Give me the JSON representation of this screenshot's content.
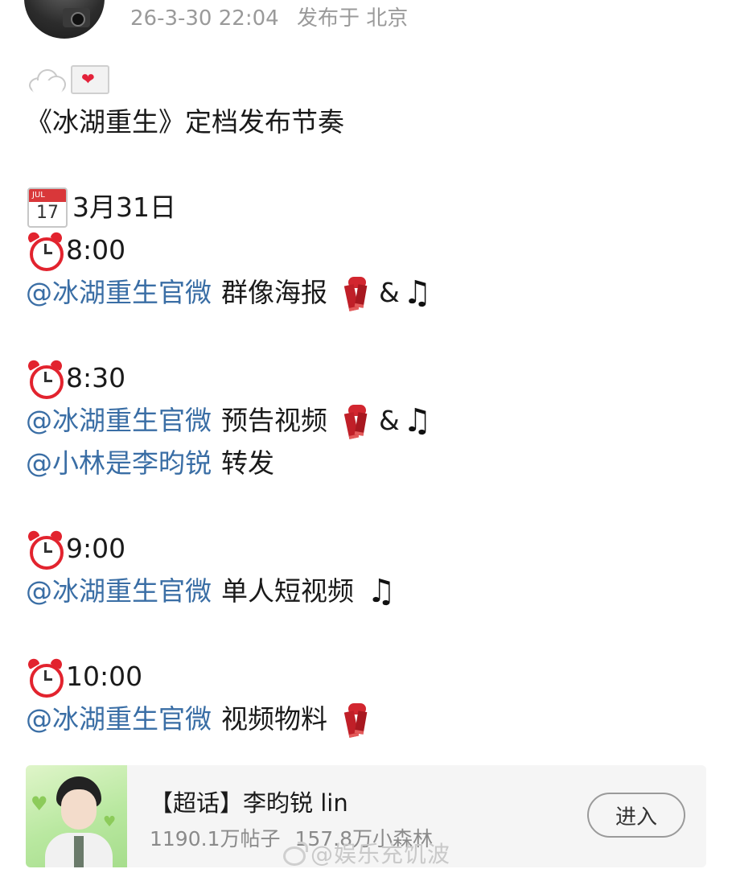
{
  "header": {
    "datetime": "26-3-30 22:04",
    "location": "发布于 北京"
  },
  "post": {
    "title": "《冰湖重生》定档发布节奏",
    "date": "3月31日",
    "calendar_month": "JUL",
    "calendar_day": "17",
    "schedule": [
      {
        "time": "8:00",
        "items": [
          {
            "mention": "@冰湖重生官微",
            "text": "群像海报",
            "emojis": [
              "scarf",
              "&",
              "music-note"
            ]
          }
        ]
      },
      {
        "time": "8:30",
        "items": [
          {
            "mention": "@冰湖重生官微",
            "text": "预告视频",
            "emojis": [
              "scarf",
              "&",
              "music-note"
            ]
          },
          {
            "mention": "@小林是李昀锐",
            "text": "转发",
            "emojis": []
          }
        ]
      },
      {
        "time": "9:00",
        "items": [
          {
            "mention": "@冰湖重生官微",
            "text": "单人短视频",
            "emojis": [
              "music-note"
            ]
          }
        ]
      },
      {
        "time": "10:00",
        "items": [
          {
            "mention": "@冰湖重生官微",
            "text": "视频物料",
            "emojis": [
              "scarf"
            ]
          }
        ]
      }
    ],
    "amp": "&",
    "note": "♫"
  },
  "card": {
    "title": "【超话】李昀锐 lin",
    "posts": "1190.1万帖子",
    "fans": "157.8万小森林",
    "button": "进入"
  },
  "watermark": "@娱乐充饥波",
  "colors": {
    "mention": "#3a6ea5",
    "meta": "#9a9a9a",
    "card_bg": "#f5f5f5"
  }
}
